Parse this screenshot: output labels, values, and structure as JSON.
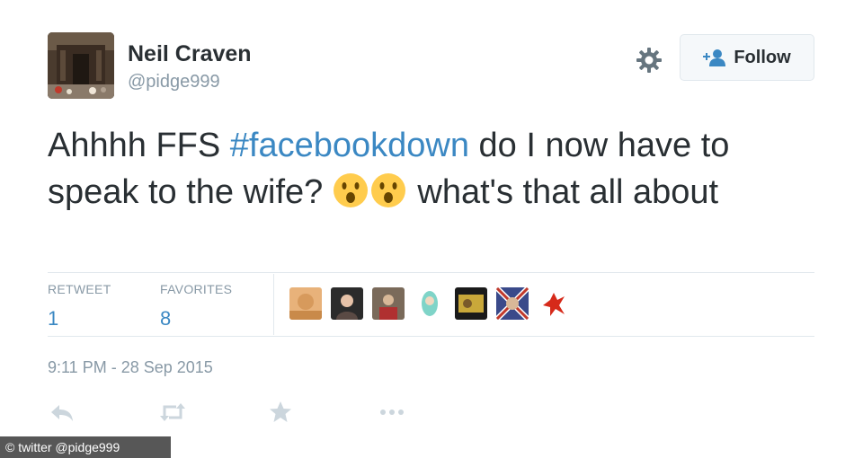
{
  "user": {
    "name": "Neil Craven",
    "handle": "@pidge999"
  },
  "follow_button": {
    "label": "Follow"
  },
  "tweet": {
    "text_before": "Ahhhh FFS ",
    "hashtag": "#facebookdown",
    "text_middle": " do I now have to speak to the wife? ",
    "text_after": " what's that all about",
    "emojis": [
      "hushed-face",
      "hushed-face"
    ]
  },
  "stats": {
    "retweets": {
      "label": "RETWEET",
      "value": "1"
    },
    "favorites": {
      "label": "FAVORITES",
      "value": "8"
    }
  },
  "favoriters_count_shown": 7,
  "timestamp": "9:11 PM - 28 Sep 2015",
  "actions": [
    "reply-icon",
    "retweet-icon",
    "favorite-icon",
    "more-icon"
  ],
  "credit": "© twitter @pidge999",
  "colors": {
    "link": "#3b88c3",
    "muted": "#8899a6",
    "text": "#292f33",
    "border": "#e1e8ed"
  }
}
